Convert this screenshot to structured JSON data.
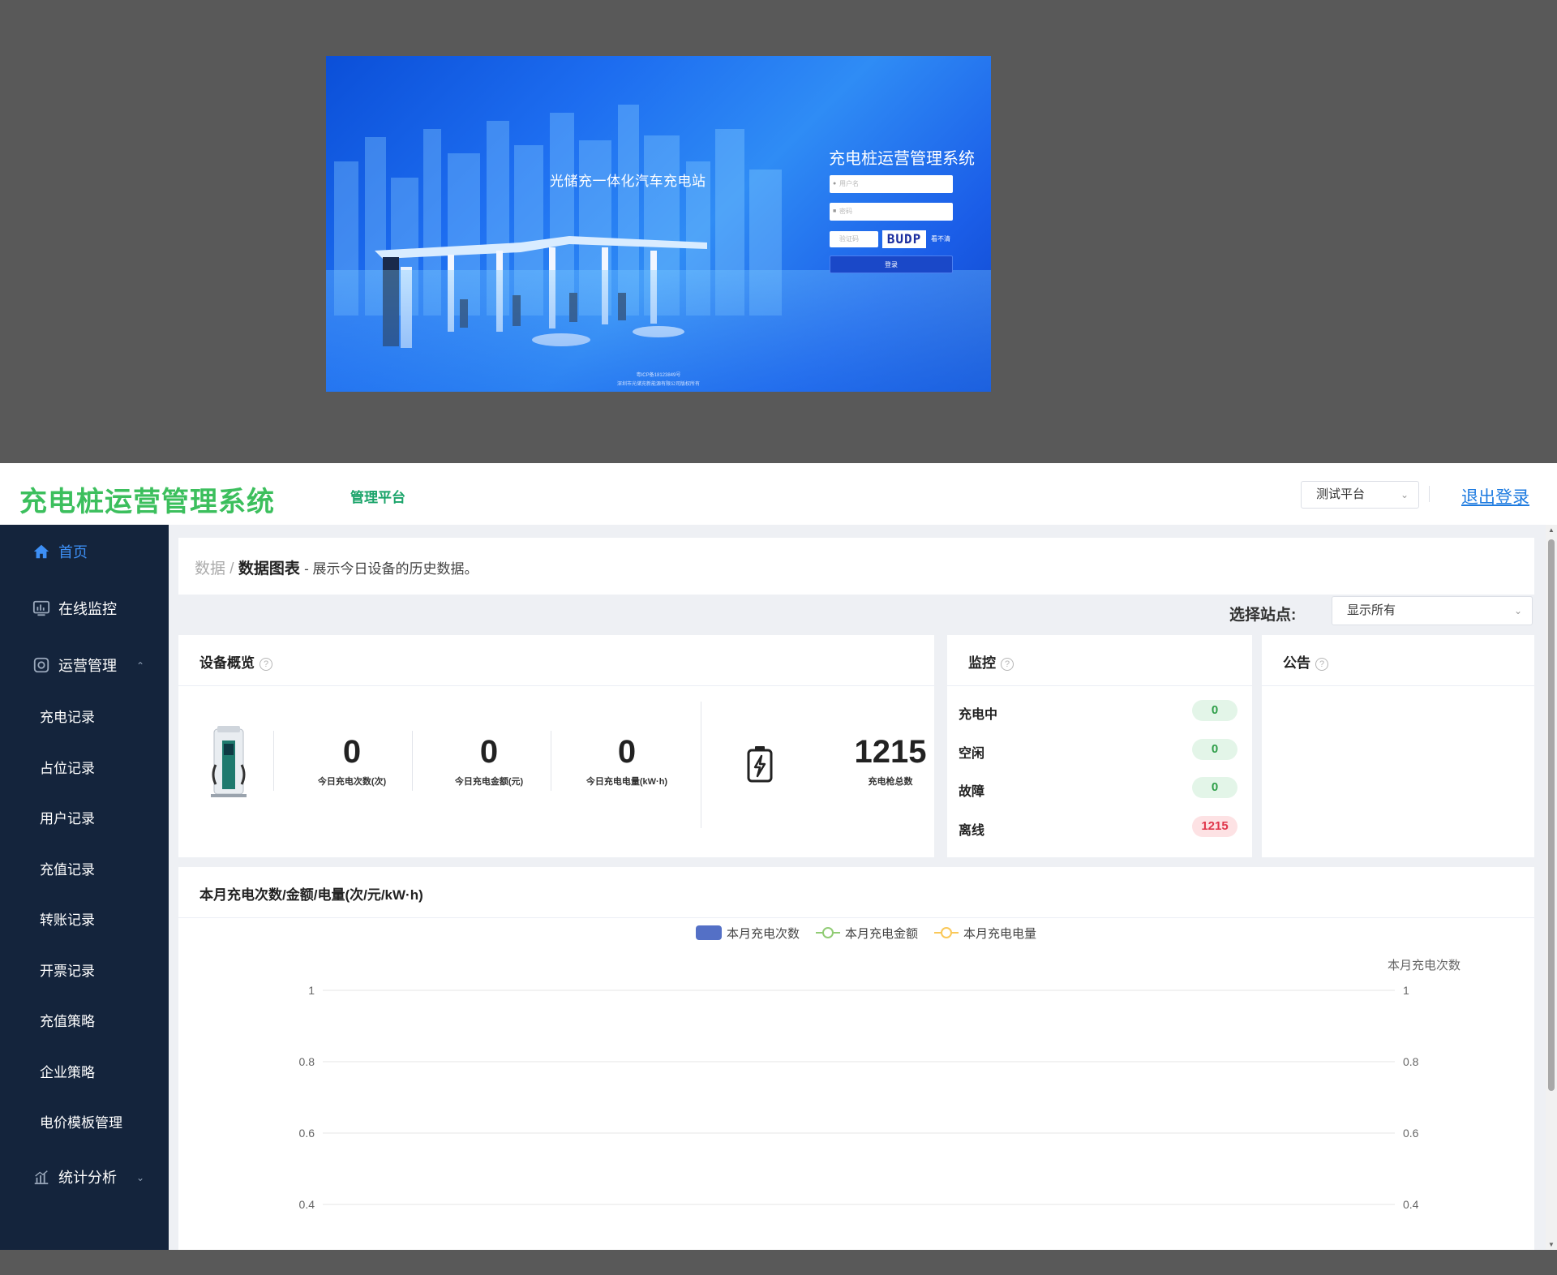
{
  "login": {
    "station_title": "光储充一体化汽车充电站",
    "title": "充电桩运营管理系统",
    "username_placeholder": "用户名",
    "password_placeholder": "密码",
    "captcha_placeholder": "验证码",
    "captcha_text": "BUDP",
    "captcha_refresh": "看不清",
    "login_button": "登录",
    "footer_line1": "粤ICP备18123849号",
    "footer_line2": "深圳市光储充新能源有限公司版权所有"
  },
  "header": {
    "logo": "充电桩运营管理系统",
    "platform": "管理平台",
    "platform_select": "测试平台",
    "logout": "退出登录"
  },
  "sidebar": {
    "items": [
      {
        "label": "首页",
        "icon": "home-icon"
      },
      {
        "label": "在线监控",
        "icon": "monitor-icon"
      },
      {
        "label": "运营管理",
        "icon": "operation-icon"
      },
      {
        "label": "统计分析",
        "icon": "chart-icon"
      }
    ],
    "sub_items": [
      "充电记录",
      "占位记录",
      "用户记录",
      "充值记录",
      "转账记录",
      "开票记录",
      "充值策略",
      "企业策略",
      "电价模板管理"
    ]
  },
  "breadcrumb": {
    "root": "数据",
    "sep": "/",
    "current": "数据图表",
    "desc": "- 展示今日设备的历史数据。"
  },
  "station": {
    "label": "选择站点:",
    "value": "显示所有"
  },
  "overview": {
    "title": "设备概览",
    "stats": [
      {
        "value": "0",
        "label": "今日充电次数(次)"
      },
      {
        "value": "0",
        "label": "今日充电金额(元)"
      },
      {
        "value": "0",
        "label": "今日充电电量(kW·h)"
      }
    ],
    "total": {
      "value": "1215",
      "label": "充电枪总数"
    }
  },
  "monitor": {
    "title": "监控",
    "rows": [
      {
        "label": "充电中",
        "value": "0",
        "status": "ok"
      },
      {
        "label": "空闲",
        "value": "0",
        "status": "ok"
      },
      {
        "label": "故障",
        "value": "0",
        "status": "ok"
      },
      {
        "label": "离线",
        "value": "1215",
        "status": "bad"
      }
    ]
  },
  "notice": {
    "title": "公告"
  },
  "chart_data": {
    "type": "bar",
    "title": "本月充电次数/金额/电量(次/元/kW·h)",
    "series": [
      {
        "name": "本月充电次数",
        "type": "bar",
        "color": "#5470c6",
        "values": []
      },
      {
        "name": "本月充电金额",
        "type": "line",
        "color": "#91cc75",
        "values": []
      },
      {
        "name": "本月充电电量",
        "type": "line",
        "color": "#fac858",
        "values": []
      }
    ],
    "ylabel_right": "本月充电次数",
    "ticks": [
      "1",
      "0.8",
      "0.6",
      "0.4"
    ],
    "tick_values": [
      1,
      0.8,
      0.6,
      0.4
    ],
    "ylim": [
      0,
      1
    ],
    "grid": true,
    "legend": "top-center"
  },
  "colors": {
    "logo_green": "#3cbf5d",
    "sidebar_bg": "#14243c",
    "active_blue": "#3d8ff5",
    "link_blue": "#1e7be0"
  }
}
